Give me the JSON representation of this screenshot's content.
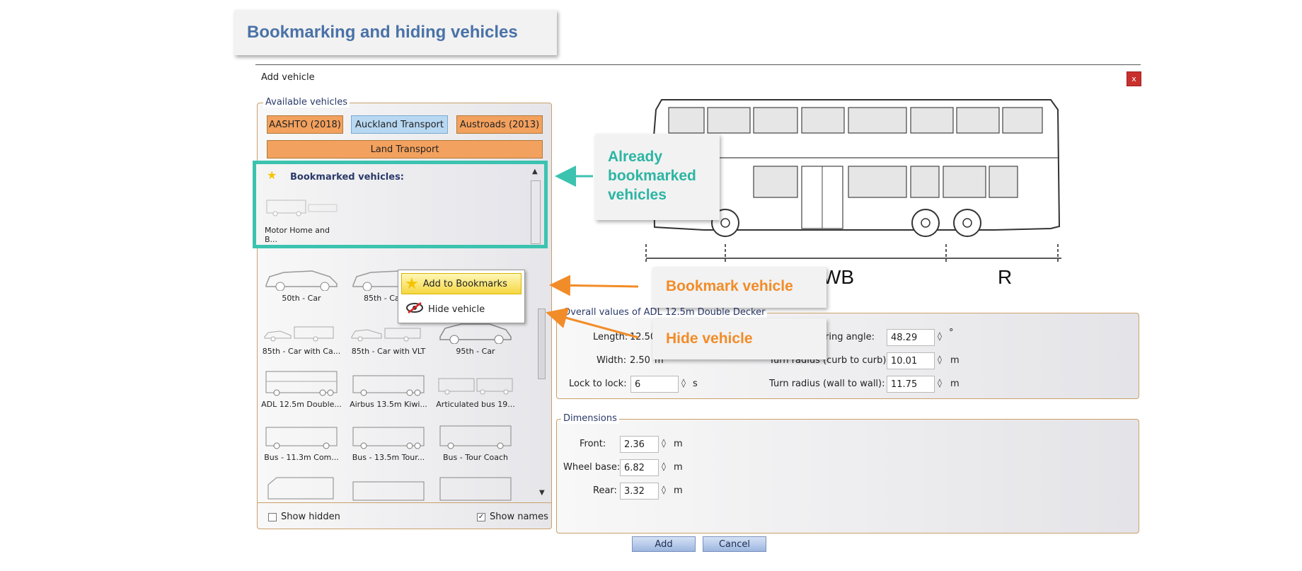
{
  "slide_title": "Bookmarking and hiding vehicles",
  "window": {
    "title": "Add vehicle",
    "close_label": "x"
  },
  "available": {
    "legend": "Available vehicles",
    "tabs": [
      "AASHTO (2018)",
      "Auckland Transport",
      "Austroads (2013)"
    ],
    "land_transport": "Land Transport",
    "bookmarked_header": "Bookmarked vehicles:",
    "bookmarked_items": [
      "Motor Home and B..."
    ],
    "grid_items": [
      "50th - Car",
      "85th - Car",
      "",
      "85th - Car with Ca...",
      "85th - Car with VLT",
      "95th - Car",
      "ADL 12.5m Double...",
      "Airbus 13.5m Kiwi...",
      "Articulated bus 19...",
      "Bus - 11.3m Com...",
      "Bus - 13.5m Tour...",
      "Bus - Tour Coach"
    ],
    "show_hidden": "Show hidden",
    "show_names": "Show names"
  },
  "context_menu": {
    "add": "Add to Bookmarks",
    "hide": "Hide vehicle"
  },
  "callouts": {
    "already": "Already bookmarked vehicles",
    "bookmark": "Bookmark vehicle",
    "hide": "Hide vehicle"
  },
  "diagram": {
    "label_wb": "WB",
    "label_r": "R"
  },
  "overall": {
    "legend": "Overall values of ADL 12.5m Double Decker",
    "length_label": "Length:",
    "length_value": "12.50",
    "width_label": "Width:",
    "width_value": "2.50",
    "width_unit": "m",
    "lock_label": "Lock to lock:",
    "lock_value": "6",
    "lock_unit": "s",
    "steer_label": "eering angle:",
    "steer_value": "48.29",
    "steer_unit": "°",
    "turn_curb_label": "Turn radius (curb to curb):",
    "turn_curb_value": "10.01",
    "turn_curb_unit": "m",
    "turn_wall_label": "Turn radius (wall to wall):",
    "turn_wall_value": "11.75",
    "turn_wall_unit": "m"
  },
  "dimensions": {
    "legend": "Dimensions",
    "front_label": "Front:",
    "front_value": "2.36",
    "wheelbase_label": "Wheel base:",
    "wheelbase_value": "6.82",
    "rear_label": "Rear:",
    "rear_value": "3.32",
    "unit": "m"
  },
  "buttons": {
    "add": "Add",
    "cancel": "Cancel"
  },
  "colors": {
    "teal": "#3cc3b0",
    "orange": "#f28c28",
    "title_blue": "#4a72a8"
  }
}
